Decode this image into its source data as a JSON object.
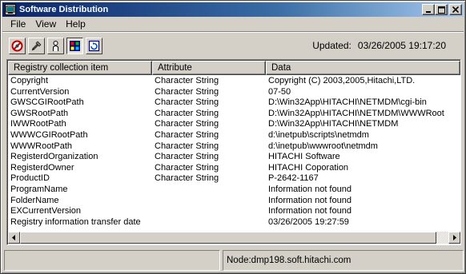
{
  "window": {
    "title": "Software Distribution",
    "controls": {
      "minimize": "_",
      "maximize": "□",
      "close": "×"
    }
  },
  "menu": {
    "items": [
      "File",
      "View",
      "Help"
    ]
  },
  "toolbar": {
    "buttons": [
      {
        "icon": "stop-icon"
      },
      {
        "icon": "wrench-icon"
      },
      {
        "icon": "person-icon"
      },
      {
        "icon": "registry-icon",
        "pressed": true
      },
      {
        "icon": "refresh-icon"
      }
    ],
    "updated_label": "Updated:",
    "updated_value": "03/26/2005 19:17:20"
  },
  "table": {
    "columns": [
      "Registry collection item",
      "Attribute",
      "Data"
    ],
    "rows": [
      [
        "Copyright",
        "Character String",
        "Copyright (C) 2003,2005,Hitachi,LTD."
      ],
      [
        "CurrentVersion",
        "Character String",
        "07-50"
      ],
      [
        "GWSCGIRootPath",
        "Character String",
        "D:\\Win32App\\HITACHI\\NETMDM\\cgi-bin"
      ],
      [
        "GWSRootPath",
        "Character String",
        "D:\\Win32App\\HITACHI\\NETMDM\\WWWRoot"
      ],
      [
        "IWWRootPath",
        "Character String",
        "D:\\Win32App\\HITACHI\\NETMDM"
      ],
      [
        "WWWCGIRootPath",
        "Character String",
        "d:\\inetpub\\scripts\\netmdm"
      ],
      [
        "WWWRootPath",
        "Character String",
        "d:\\inetpub\\wwwroot\\netmdm"
      ],
      [
        "RegisterdOrganization",
        "Character String",
        "HITACHI Software"
      ],
      [
        "RegisterdOwner",
        "Character String",
        "HITACHI Coporation"
      ],
      [
        "ProductID",
        "Character String",
        "P-2642-1167"
      ],
      [
        "ProgramName",
        "",
        "Information not found"
      ],
      [
        "FolderName",
        "",
        "Information not found"
      ],
      [
        "EXCurrentVersion",
        "",
        "Information not found"
      ],
      [
        "Registry information transfer date",
        "",
        "03/26/2005 19:27:59"
      ]
    ]
  },
  "statusbar": {
    "left": "",
    "right": "Node:dmp198.soft.hitachi.com"
  },
  "colors": {
    "title_start": "#0a246a",
    "title_end": "#a6caf0",
    "face": "#d4d0c8"
  }
}
